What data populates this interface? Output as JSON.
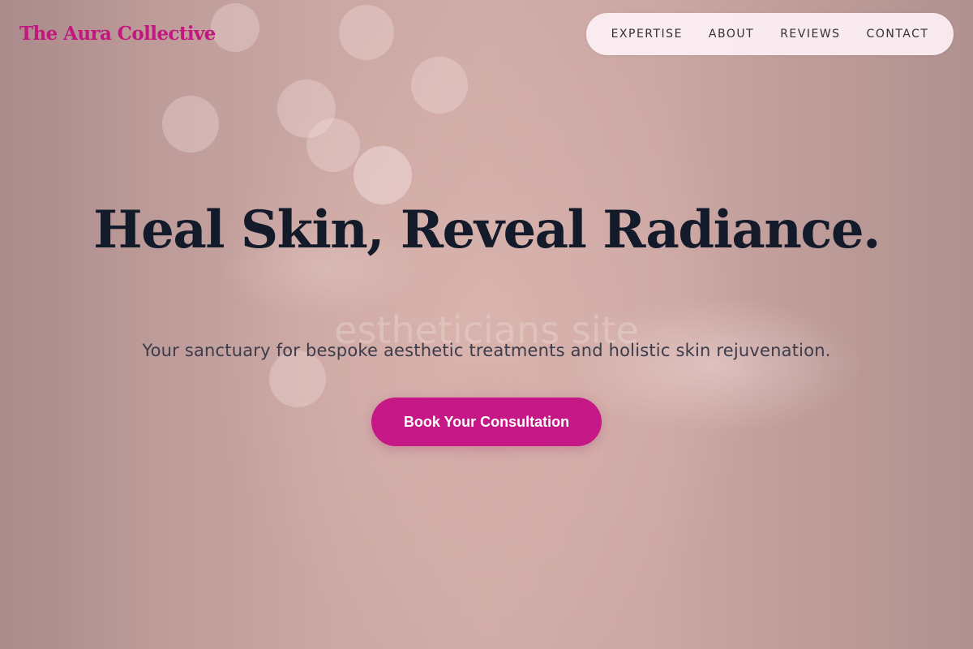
{
  "brand": {
    "name": "The Aura Collective",
    "color": "#c2177f"
  },
  "nav": {
    "items": [
      {
        "label": "EXPERTISE"
      },
      {
        "label": "ABOUT"
      },
      {
        "label": "REVIEWS"
      },
      {
        "label": "CONTACT"
      }
    ]
  },
  "hero": {
    "title": "Heal Skin, Reveal Radiance.",
    "watermark": "estheticians site",
    "subtitle": "Your sanctuary for bespoke aesthetic treatments and holistic skin rejuvenation.",
    "cta_label": "Book Your Consultation",
    "cta_color": "#c51785"
  }
}
